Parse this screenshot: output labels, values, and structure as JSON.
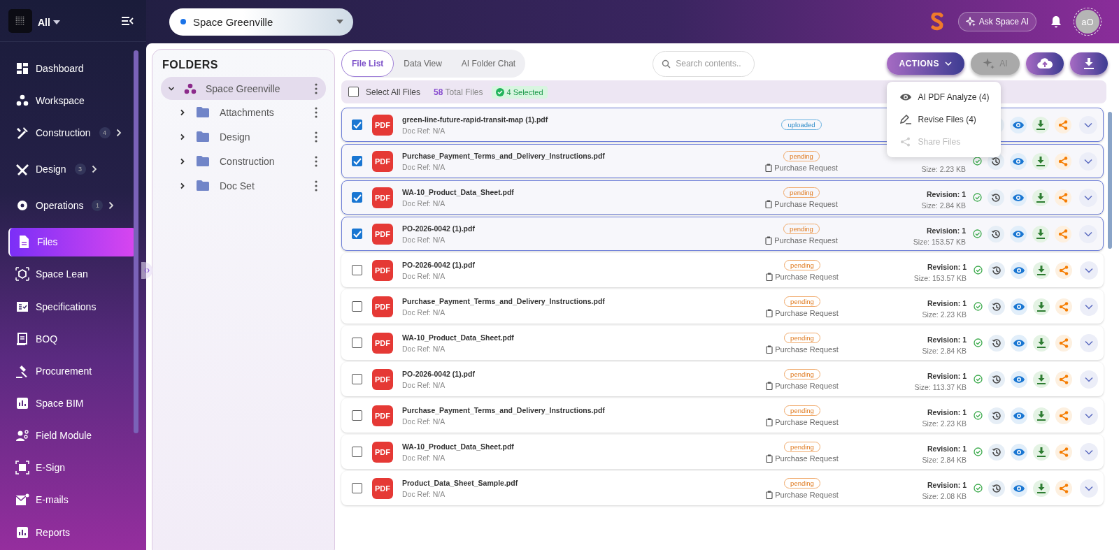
{
  "sidebar": {
    "workspace": "All",
    "items": [
      {
        "label": "Dashboard",
        "expandable": false,
        "selected": false
      },
      {
        "label": "Workspace",
        "expandable": false,
        "selected": false
      },
      {
        "label": "Construction",
        "badge": "4",
        "expandable": true,
        "selected": false
      },
      {
        "label": "Design",
        "badge": "3",
        "expandable": true,
        "selected": false
      },
      {
        "label": "Operations",
        "badge": "1",
        "expandable": true,
        "selected": false
      },
      {
        "label": "Files",
        "expandable": false,
        "selected": true
      },
      {
        "label": "Space Lean",
        "expandable": false,
        "selected": false
      },
      {
        "label": "Specifications",
        "expandable": false,
        "selected": false
      },
      {
        "label": "BOQ",
        "expandable": false,
        "selected": false
      },
      {
        "label": "Procurement",
        "expandable": false,
        "selected": false
      },
      {
        "label": "Space BIM",
        "expandable": false,
        "selected": false
      },
      {
        "label": "Field Module",
        "expandable": false,
        "selected": false
      },
      {
        "label": "E-Sign",
        "expandable": false,
        "selected": false
      },
      {
        "label": "E-mails",
        "expandable": false,
        "selected": false
      },
      {
        "label": "Reports",
        "expandable": false,
        "selected": false
      }
    ]
  },
  "topbar": {
    "space_selector": "Space Greenville",
    "ask_ai": "Ask Space AI",
    "avatar": "aO"
  },
  "folders": {
    "title": "FOLDERS",
    "root": {
      "label": "Space Greenville",
      "expanded": true,
      "selected": true,
      "children": [
        {
          "label": "Attachments",
          "expanded": false
        },
        {
          "label": "Design",
          "expanded": false
        },
        {
          "label": "Construction",
          "expanded": false
        },
        {
          "label": "Doc Set",
          "expanded": false
        }
      ]
    }
  },
  "tabs": [
    {
      "label": "File List",
      "selected": true
    },
    {
      "label": "Data View",
      "selected": false
    },
    {
      "label": "AI Folder Chat",
      "selected": false
    }
  ],
  "search": {
    "placeholder": "Search contents.."
  },
  "toolbar": {
    "actions": "ACTIONS",
    "ai": "AI",
    "ai_disabled": true
  },
  "actions_menu": [
    {
      "label": "AI PDF Analyze (4)",
      "kind": "analyze",
      "disabled": false
    },
    {
      "label": "Revise Files (4)",
      "kind": "revise",
      "disabled": false
    },
    {
      "label": "Share Files",
      "kind": "share",
      "disabled": true
    }
  ],
  "selection": {
    "select_all_label": "Select All Files",
    "select_all_checked": false,
    "total_count": "58",
    "total_label": "Total Files",
    "selected_label": "4 Selected"
  },
  "files": [
    {
      "name": "green-line-future-rapid-transit-map (1).pdf",
      "doc_ref": "Doc Ref: N/A",
      "selected": true,
      "file_type": "PDF",
      "status": "uploaded",
      "kind": "uploaded"
    },
    {
      "name": "Purchase_Payment_Terms_and_Delivery_Instructions.pdf",
      "doc_ref": "Doc Ref: N/A",
      "selected": true,
      "file_type": "PDF",
      "status": "pending",
      "kind": "pending",
      "doc_type": "Purchase Request",
      "size": "Size: 2.23 KB"
    },
    {
      "name": "WA-10_Product_Data_Sheet.pdf",
      "doc_ref": "Doc Ref: N/A",
      "selected": true,
      "file_type": "PDF",
      "status": "pending",
      "kind": "pending",
      "doc_type": "Purchase Request",
      "revision": "Revision: 1",
      "size": "Size: 2.84 KB"
    },
    {
      "name": "PO-2026-0042 (1).pdf",
      "doc_ref": "Doc Ref: N/A",
      "selected": true,
      "file_type": "PDF",
      "status": "pending",
      "kind": "pending",
      "doc_type": "Purchase Request",
      "revision": "Revision: 1",
      "size": "Size: 153.57 KB"
    },
    {
      "name": "PO-2026-0042 (1).pdf",
      "doc_ref": "Doc Ref: N/A",
      "selected": false,
      "file_type": "PDF",
      "status": "pending",
      "kind": "pending",
      "doc_type": "Purchase Request",
      "revision": "Revision: 1",
      "size": "Size: 153.57 KB"
    },
    {
      "name": "Purchase_Payment_Terms_and_Delivery_Instructions.pdf",
      "doc_ref": "Doc Ref: N/A",
      "selected": false,
      "file_type": "PDF",
      "status": "pending",
      "kind": "pending",
      "doc_type": "Purchase Request",
      "revision": "Revision: 1",
      "size": "Size: 2.23 KB"
    },
    {
      "name": "WA-10_Product_Data_Sheet.pdf",
      "doc_ref": "Doc Ref: N/A",
      "selected": false,
      "file_type": "PDF",
      "status": "pending",
      "kind": "pending",
      "doc_type": "Purchase Request",
      "revision": "Revision: 1",
      "size": "Size: 2.84 KB"
    },
    {
      "name": "PO-2026-0042 (1).pdf",
      "doc_ref": "Doc Ref: N/A",
      "selected": false,
      "file_type": "PDF",
      "status": "pending",
      "kind": "pending",
      "doc_type": "Purchase Request",
      "revision": "Revision: 1",
      "size": "Size: 113.37 KB"
    },
    {
      "name": "Purchase_Payment_Terms_and_Delivery_Instructions.pdf",
      "doc_ref": "Doc Ref: N/A",
      "selected": false,
      "file_type": "PDF",
      "status": "pending",
      "kind": "pending",
      "doc_type": "Purchase Request",
      "revision": "Revision: 1",
      "size": "Size: 2.23 KB"
    },
    {
      "name": "WA-10_Product_Data_Sheet.pdf",
      "doc_ref": "Doc Ref: N/A",
      "selected": false,
      "file_type": "PDF",
      "status": "pending",
      "kind": "pending",
      "doc_type": "Purchase Request",
      "revision": "Revision: 1",
      "size": "Size: 2.84 KB"
    },
    {
      "name": "Product_Data_Sheet_Sample.pdf",
      "doc_ref": "Doc Ref: N/A",
      "selected": false,
      "file_type": "PDF",
      "status": "pending",
      "kind": "pending",
      "doc_type": "Purchase Request",
      "revision": "Revision: 1",
      "size": "Size: 2.08 KB"
    }
  ]
}
